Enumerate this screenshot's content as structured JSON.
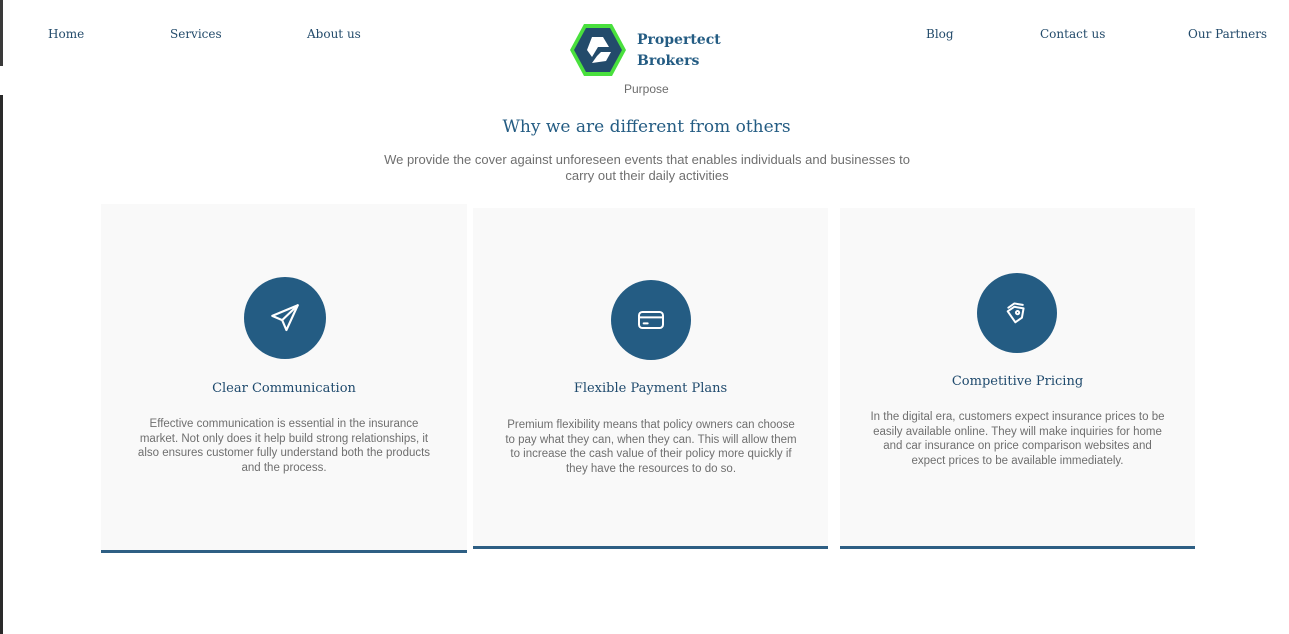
{
  "nav": {
    "home": "Home",
    "services": "Services",
    "about": "About us",
    "blog": "Blog",
    "contact": "Contact us",
    "partners": "Our Partners"
  },
  "brand": {
    "line1": "Propertect",
    "line2": "Brokers",
    "logo_icon": "hexagon-logo-icon"
  },
  "section": {
    "eyebrow": "Purpose",
    "heading": "Why we are different from others",
    "subtext": "We provide the cover against unforeseen events that enables individuals and businesses to carry out their daily activities"
  },
  "cards": [
    {
      "icon": "paper-plane-icon",
      "title": "Clear Communication",
      "body": "Effective communication is essential in the insurance market. Not only does it help build strong relationships, it also ensures customer fully understand both the products and the process."
    },
    {
      "icon": "credit-card-icon",
      "title": "Flexible Payment Plans",
      "body": "Premium flexibility means that policy owners can choose to pay what they can, when they can. This will allow them to increase the cash value of their policy more quickly if they have the resources to do so."
    },
    {
      "icon": "price-tag-icon",
      "title": "Competitive Pricing",
      "body": "In the digital era, customers expect insurance prices to be easily available online. They will make inquiries for home and car insurance on price comparison websites and expect prices to be available immediately."
    }
  ],
  "colors": {
    "primary": "#245c83",
    "logo_green": "#49e03d",
    "card_bg": "#f9f9f9",
    "text_gray": "#6f6f6f"
  }
}
